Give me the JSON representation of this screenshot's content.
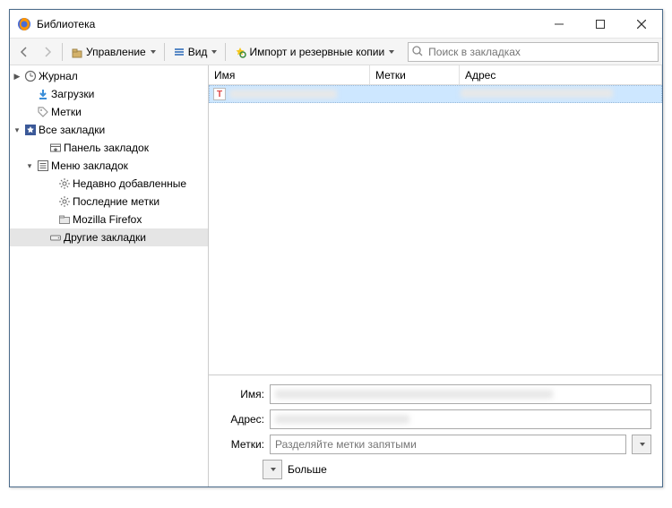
{
  "window": {
    "title": "Библиотека"
  },
  "toolbar": {
    "manage": "Управление",
    "view": "Вид",
    "import": "Импорт и резервные копии",
    "search_placeholder": "Поиск в закладках"
  },
  "sidebar": {
    "journal": "Журнал",
    "downloads": "Загрузки",
    "tags": "Метки",
    "all_bookmarks": "Все закладки",
    "bookmarks_toolbar": "Панель закладок",
    "bookmarks_menu": "Меню закладок",
    "recently_added": "Недавно добавленные",
    "recent_tags": "Последние метки",
    "mozilla": "Mozilla Firefox",
    "other_bookmarks": "Другие закладки"
  },
  "columns": {
    "name": "Имя",
    "tags": "Метки",
    "address": "Адрес"
  },
  "row": {
    "icon_letter": "T"
  },
  "details": {
    "name_label": "Имя:",
    "address_label": "Адрес:",
    "tags_label": "Метки:",
    "tags_placeholder": "Разделяйте метки запятыми",
    "more": "Больше"
  }
}
